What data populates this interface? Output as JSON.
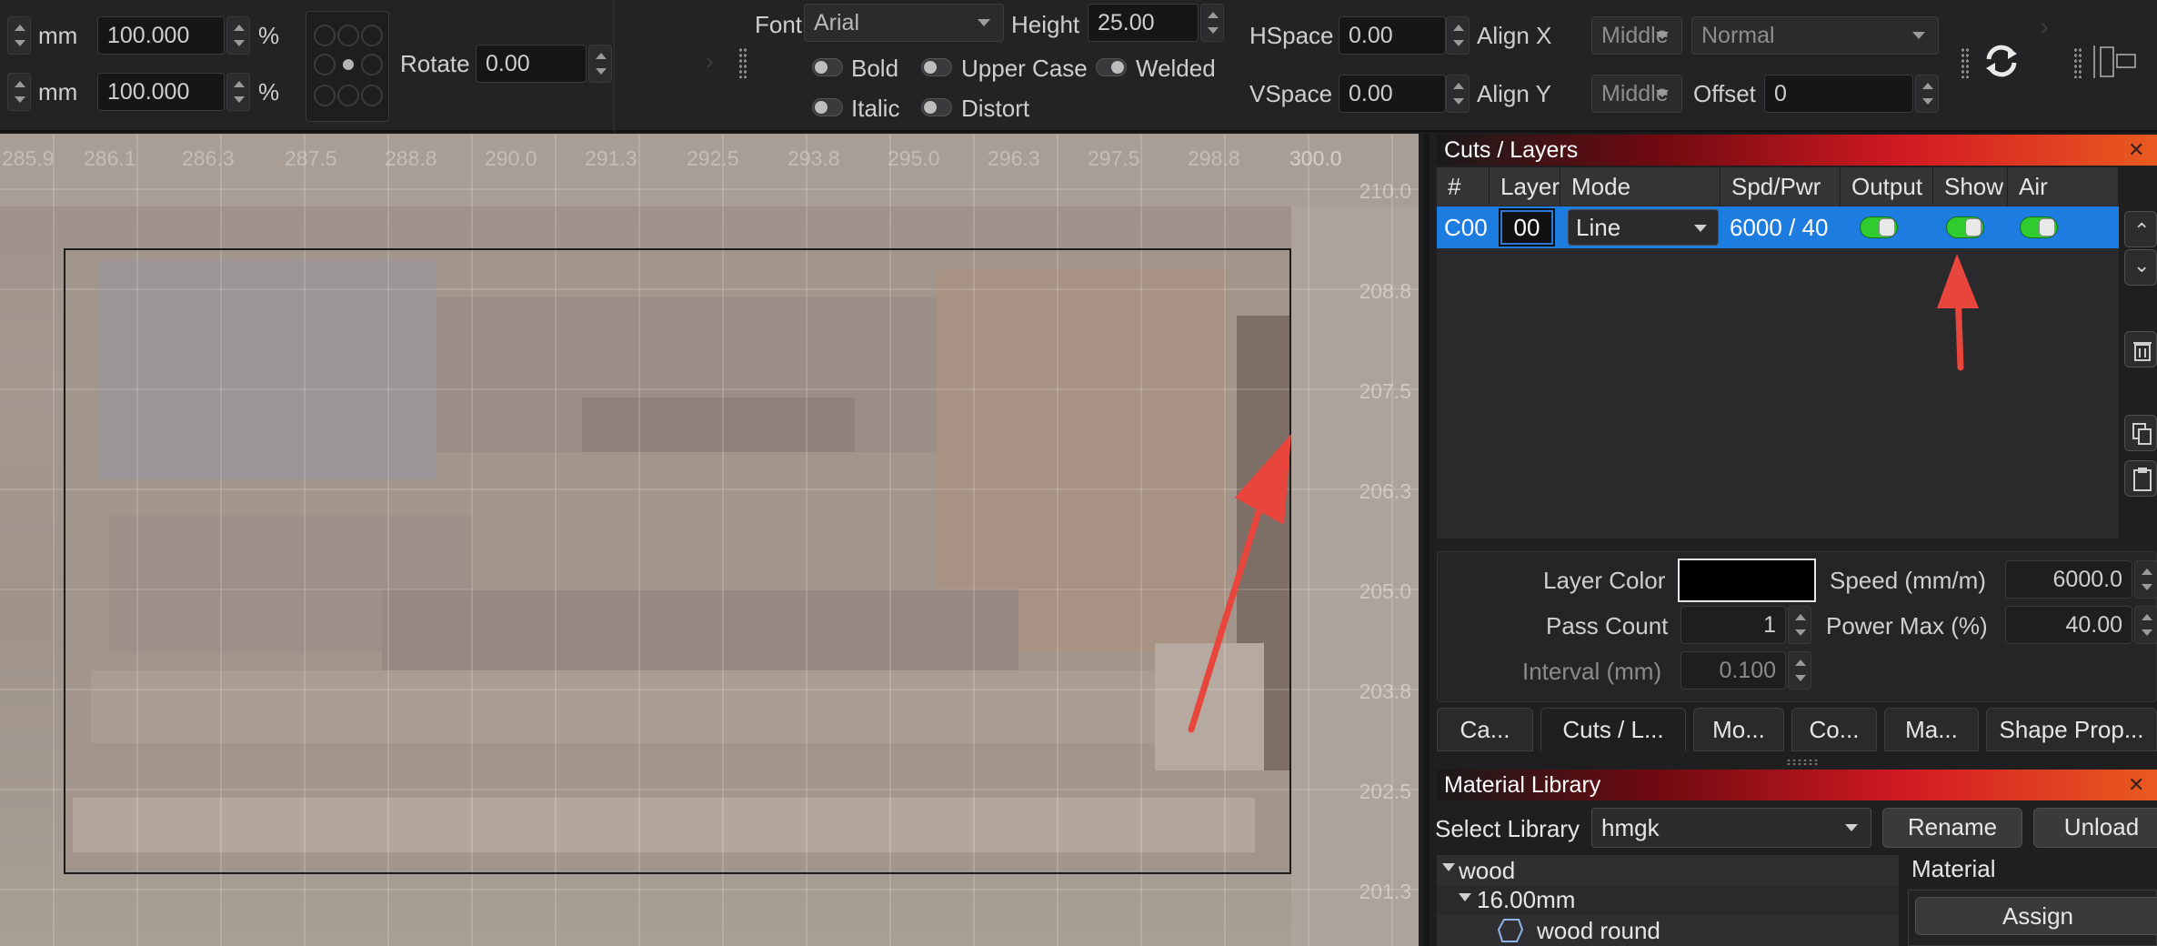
{
  "toolbar": {
    "scale_unit": "mm",
    "width_pct": "100.000",
    "height_pct": "100.000",
    "pct_symbol": "%",
    "rotate_label": "Rotate",
    "rotate_value": "0.00",
    "font_label": "Font",
    "font_value": "Arial",
    "height_label": "Height",
    "height_value": "25.00",
    "bold_label": "Bold",
    "upper_case_label": "Upper Case",
    "welded_label": "Welded",
    "italic_label": "Italic",
    "distort_label": "Distort",
    "hspace_label": "HSpace",
    "hspace_value": "0.00",
    "vspace_label": "VSpace",
    "vspace_value": "0.00",
    "align_x_label": "Align X",
    "align_x_value": "Middle",
    "align_y_label": "Align Y",
    "align_y_value": "Middle",
    "normal_value": "Normal",
    "offset_label": "Offset",
    "offset_value": "0",
    "refresh_icon": "refresh-icon",
    "frame_icon": "frame-icon"
  },
  "canvas": {
    "ruler_x": [
      "285.9",
      "286.1",
      "286.3",
      "287.5",
      "288.8",
      "290.0",
      "291.3",
      "292.5",
      "293.8",
      "295.0",
      "296.3",
      "297.5",
      "298.8",
      "300.0"
    ],
    "ruler_y": [
      "210.0",
      "208.8",
      "207.5",
      "206.3",
      "205.0",
      "203.8",
      "202.5",
      "201.3"
    ]
  },
  "cuts_layers": {
    "title": "Cuts / Layers",
    "headers": [
      "#",
      "Layer",
      "Mode",
      "Spd/Pwr",
      "Output",
      "Show",
      "Air"
    ],
    "row": {
      "id": "C00",
      "layer": "00",
      "mode": "Line",
      "spd_pwr": "6000 / 40",
      "output": true,
      "show": true,
      "air": true
    },
    "layer_color_label": "Layer Color",
    "layer_color": "#000000",
    "speed_label": "Speed (mm/m)",
    "speed_value": "6000.0",
    "pass_count_label": "Pass Count",
    "pass_count_value": "1",
    "power_max_label": "Power Max (%)",
    "power_max_value": "40.00",
    "interval_label": "Interval (mm)",
    "interval_value": "0.100"
  },
  "tabs": [
    "Ca...",
    "Cuts / L...",
    "Mo...",
    "Co...",
    "Ma...",
    "Shape Prop..."
  ],
  "material_library": {
    "title": "Material Library",
    "select_library_label": "Select Library",
    "library_value": "hmgk",
    "rename_label": "Rename",
    "unload_label": "Unload",
    "tree": [
      "wood",
      "16.00mm",
      "wood round"
    ],
    "material_label": "Material",
    "assign_label": "Assign"
  },
  "colors": {
    "accent_blue": "#1c7ce0",
    "toggle_green": "#2fcb2f",
    "annotation_red": "#e8453c"
  }
}
